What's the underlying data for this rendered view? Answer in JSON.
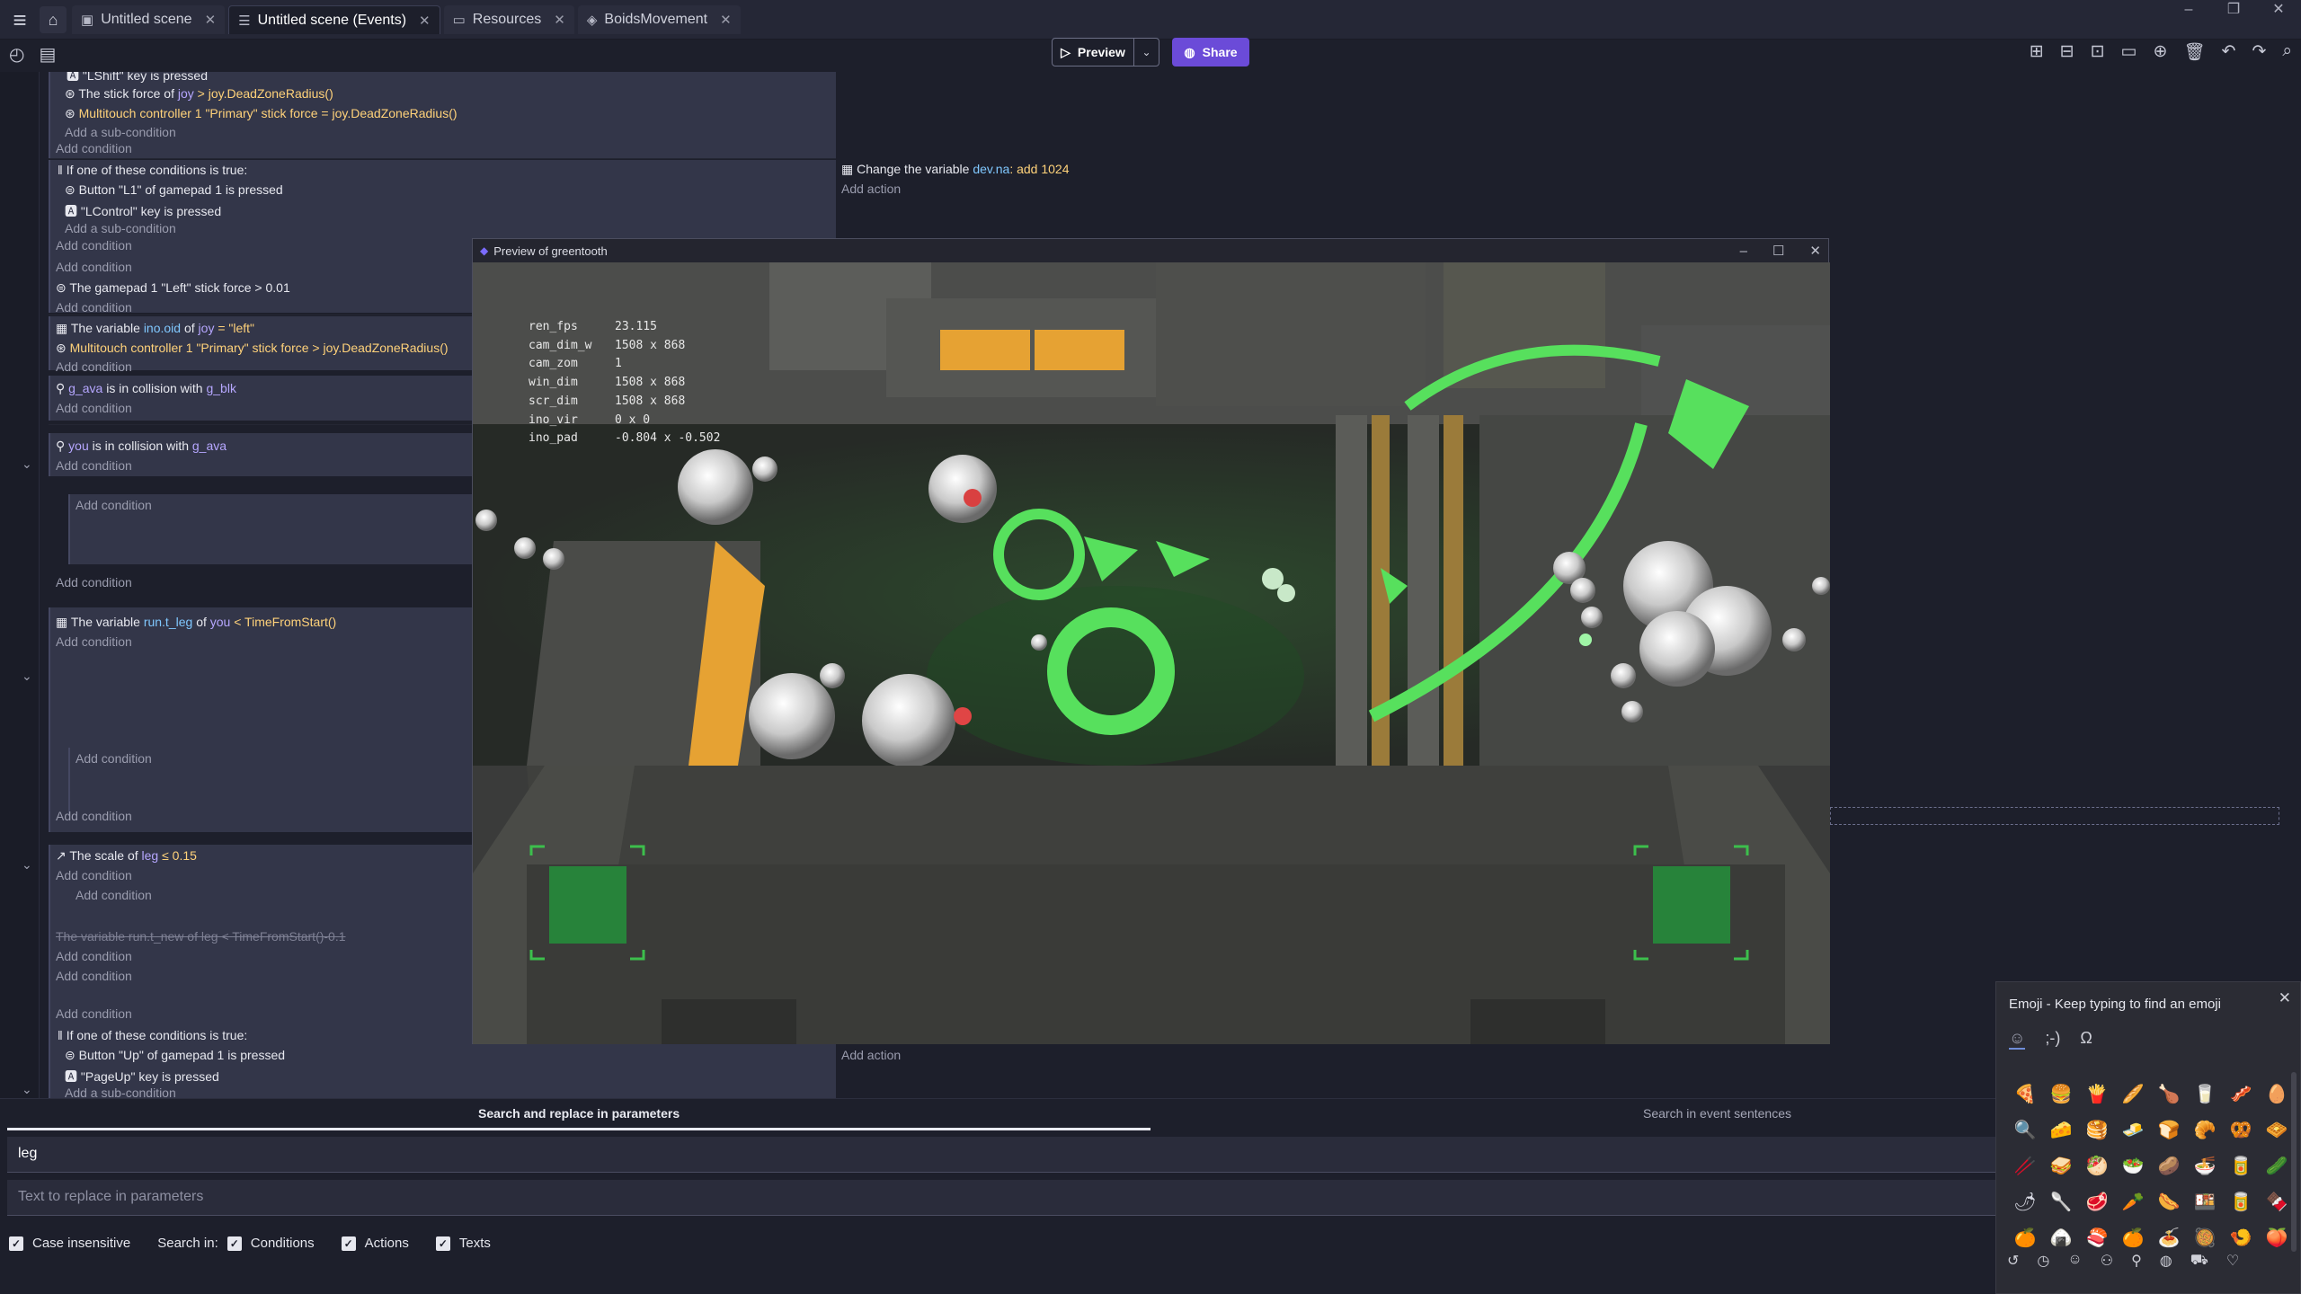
{
  "tabs": [
    {
      "label": "Untitled scene",
      "icon": "scene-icon"
    },
    {
      "label": "Untitled scene (Events)",
      "icon": "events-icon"
    },
    {
      "label": "Resources",
      "icon": "resources-icon"
    },
    {
      "label": "BoidsMovement",
      "icon": "extension-icon"
    }
  ],
  "toolbar": {
    "preview_label": "Preview",
    "share_label": "Share"
  },
  "events": {
    "c1": "\"LShift\" key is pressed",
    "c2a": "The stick force of",
    "c2b": "joy",
    "c2c": "> joy.DeadZoneRadius()",
    "c3a": "Multitouch controller 1 \"Primary\" stick force = joy.DeadZoneRadius()",
    "add_sub": "Add a sub-condition",
    "add_cond": "Add condition",
    "or_title": "If one of these conditions is true:",
    "c4": "Button \"L1\" of gamepad 1 is pressed",
    "c5": "\"LControl\" key is pressed",
    "c6": "The gamepad 1 \"Left\" stick force > 0.01",
    "c7a": "The variable",
    "c7b": "ino.oid",
    "c7c": "of",
    "c7d": "joy",
    "c7e": "= \"left\"",
    "c8": "Multitouch controller 1 \"Primary\" stick force > joy.DeadZoneRadius()",
    "c9a": "g_ava",
    "c9b": "is in collision with",
    "c9c": "g_blk",
    "c10a": "you",
    "c10b": "is in collision with",
    "c10c": "g_ava",
    "c11a": "The variable",
    "c11b": "run.t_leg",
    "c11c": "of",
    "c11d": "you",
    "c11e": "< TimeFromStart()",
    "c12a": "The scale of",
    "c12b": "leg",
    "c12c": "≤ 0.15",
    "c13": "The variable  run.t_new  of  leg  < TimeFromStart()-0.1",
    "c14": "Button \"Up\" of gamepad 1 is pressed",
    "c15": "\"PageUp\" key is pressed",
    "action1a": "Change the variable",
    "action1b": "dev.na",
    "action1c": ": add",
    "action1d": "1024",
    "add_action": "Add action"
  },
  "preview": {
    "title": "Preview of greentooth",
    "debug": [
      {
        "k": "ren_fps",
        "v": "23.115"
      },
      {
        "k": "cam_dim_w",
        "v": "1508 x 868"
      },
      {
        "k": "cam_zom",
        "v": "1"
      },
      {
        "k": "win_dim",
        "v": "1508 x 868"
      },
      {
        "k": "scr_dim",
        "v": "1508 x 868"
      },
      {
        "k": "ino_vir",
        "v": "0 x 0"
      },
      {
        "k": "ino_pad",
        "v": "-0.804 x -0.502"
      }
    ]
  },
  "search": {
    "tab1": "Search and replace in parameters",
    "tab2": "Search in event sentences",
    "value": "leg",
    "replace_placeholder": "Text to replace in parameters",
    "case_label": "Case insensitive",
    "search_in": "Search in:",
    "conditions": "Conditions",
    "actions": "Actions",
    "texts": "Texts"
  },
  "emoji": {
    "title": "Emoji - Keep typing to find an emoji",
    "tab_kaomoji": ";-)",
    "tab_symbols": "Ω",
    "grid": [
      "🍕",
      "🍔",
      "🍟",
      "🥖",
      "🍗",
      "🥛",
      "🥓",
      "🥚",
      "🔍",
      "🧀",
      "🥞",
      "🧈",
      "🍞",
      "🥐",
      "🥨",
      "🧇",
      "🥢",
      "🥪",
      "🥙",
      "🥗",
      "🥔",
      "🍜",
      "🥫",
      "🥒",
      "🌶",
      "🥄",
      "🥩",
      "🥕",
      "🌭",
      "🍱",
      "🥫",
      "🍫",
      "🍊",
      "🍙",
      "🍣",
      "🍊",
      "🍝",
      "🥘",
      "🍤",
      "🍑"
    ]
  }
}
